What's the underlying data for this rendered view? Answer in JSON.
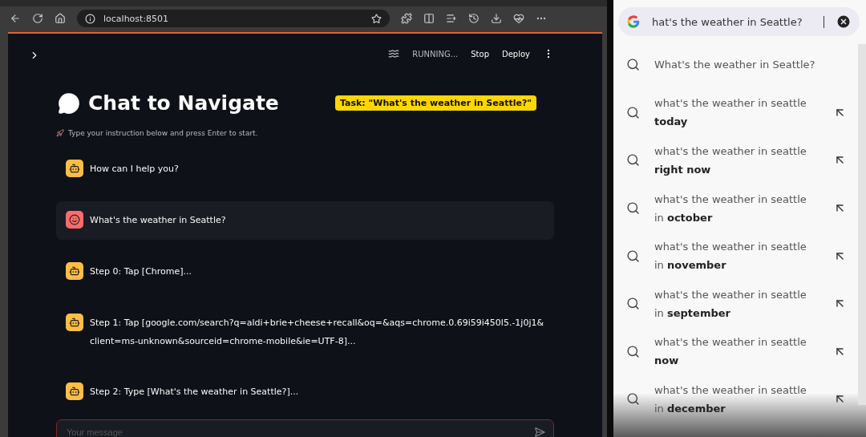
{
  "browser": {
    "address": "localhost:8501"
  },
  "app": {
    "status": "RUNNING...",
    "actions": [
      "Stop",
      "Deploy"
    ],
    "title": "Chat to Navigate",
    "task": "Task: \"What's the weather in Seattle?\"",
    "subtitle": "Type your instruction below and press Enter to start.",
    "messages": [
      {
        "kind": "assistant",
        "text": "How can I help you?"
      },
      {
        "kind": "user",
        "text": "What's the weather in Seattle?"
      },
      {
        "kind": "assistant",
        "text": "Step 0: Tap [Chrome]..."
      },
      {
        "kind": "assistant",
        "text": "Step 1: Tap [google.com/search?q=aldi+brie+cheese+recall&oq=&aqs=chrome.0.69i59i450l5.-1j0j1&client=ms-unknown&sourceid=chrome-mobile&ie=UTF-8]..."
      },
      {
        "kind": "assistant",
        "text": "Step 2: Type [What's the weather in Seattle?]..."
      }
    ],
    "input": {
      "placeholder": "Your message"
    }
  },
  "phone": {
    "query": "hat's the weather in Seattle?",
    "suggestions": [
      {
        "kind": "typed",
        "line1": "What's the weather in Seattle?"
      },
      {
        "kind": "completion",
        "line1": "what's the weather in seattle",
        "line2": "**today**"
      },
      {
        "kind": "completion",
        "line1": "what's the weather in seattle",
        "line2": "**right now**"
      },
      {
        "kind": "completion",
        "line1": "what's the weather in seattle",
        "line2": "in **october**"
      },
      {
        "kind": "completion",
        "line1": "what's the weather in seattle",
        "line2": "in **november**"
      },
      {
        "kind": "completion",
        "line1": "what's the weather in seattle",
        "line2": "in **september**"
      },
      {
        "kind": "completion",
        "line1": "what's the weather in seattle",
        "line2": "**now**"
      },
      {
        "kind": "completion",
        "line1": "what's the weather in seattle",
        "line2": "in **december**"
      }
    ]
  }
}
